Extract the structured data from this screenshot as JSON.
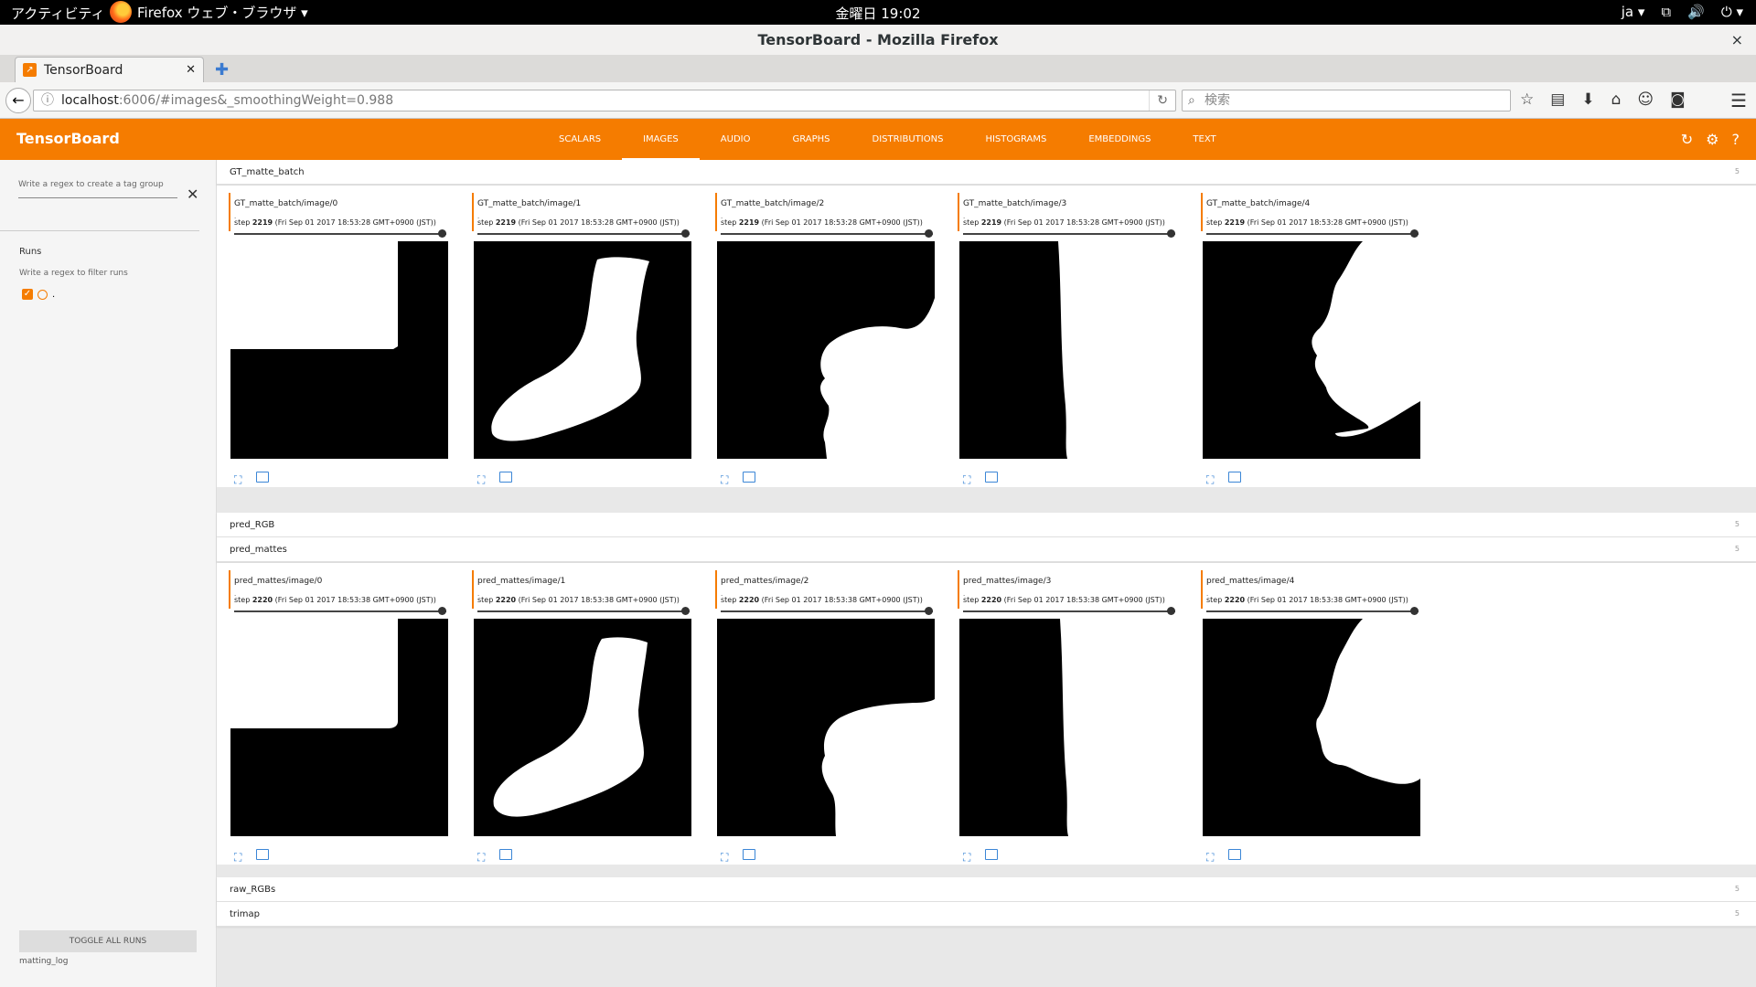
{
  "os_bar": {
    "activities": "アクティビティ",
    "app_menu": "Firefox ウェブ・ブラウザ ▾",
    "clock": "金曜日 19:02",
    "lang": "ja ▾",
    "net_icon": "⧉",
    "volume_icon": "🔊",
    "power_icon": "⏻ ▾"
  },
  "window": {
    "title": "TensorBoard - Mozilla Firefox",
    "close": "×"
  },
  "browser": {
    "tab_label": "TensorBoard",
    "tab_close": "✕",
    "new_tab": "✚",
    "url_host": "localhost",
    "url_rest": ":6006/#images&_smoothingWeight=0.988",
    "search_placeholder": "検索",
    "icons": [
      "☆",
      "▤",
      "⬇",
      "⌂",
      "☺",
      "◙"
    ],
    "menu_icon": "☰"
  },
  "tensorboard": {
    "brand": "TensorBoard",
    "tabs": [
      "SCALARS",
      "IMAGES",
      "AUDIO",
      "GRAPHS",
      "DISTRIBUTIONS",
      "HISTOGRAMS",
      "EMBEDDINGS",
      "TEXT"
    ],
    "active_tab": "IMAGES",
    "header_icons": {
      "refresh": "↻",
      "settings": "⚙",
      "help": "?"
    }
  },
  "sidebar": {
    "tag_regex_placeholder": "Write a regex to create a tag group",
    "clear": "✕",
    "runs_title": "Runs",
    "runs_filter_placeholder": "Write a regex to filter runs",
    "run_name": ".",
    "toggle_all": "TOGGLE ALL RUNS",
    "logdir": "matting_log"
  },
  "categories": [
    {
      "name": "GT_matte_batch",
      "count": "5"
    },
    {
      "name": "pred_RGB",
      "count": "5"
    },
    {
      "name": "pred_mattes",
      "count": "5"
    },
    {
      "name": "raw_RGBs",
      "count": "5"
    },
    {
      "name": "trimap",
      "count": "5"
    }
  ],
  "gt_cards": [
    {
      "title": "GT_matte_batch/image/0",
      "dot": ".",
      "step_label": "step",
      "step": "2219",
      "time": "(Fri Sep 01 2017 18:53:28 GMT+0900 (JST))"
    },
    {
      "title": "GT_matte_batch/image/1",
      "dot": ".",
      "step_label": "step",
      "step": "2219",
      "time": "(Fri Sep 01 2017 18:53:28 GMT+0900 (JST))"
    },
    {
      "title": "GT_matte_batch/image/2",
      "dot": ".",
      "step_label": "step",
      "step": "2219",
      "time": "(Fri Sep 01 2017 18:53:28 GMT+0900 (JST))"
    },
    {
      "title": "GT_matte_batch/image/3",
      "dot": ".",
      "step_label": "step",
      "step": "2219",
      "time": "(Fri Sep 01 2017 18:53:28 GMT+0900 (JST))"
    },
    {
      "title": "GT_matte_batch/image/4",
      "dot": ".",
      "step_label": "step",
      "step": "2219",
      "time": "(Fri Sep 01 2017 18:53:28 GMT+0900 (JST))"
    }
  ],
  "pred_cards": [
    {
      "title": "pred_mattes/image/0",
      "dot": ".",
      "step_label": "step",
      "step": "2220",
      "time": "(Fri Sep 01 2017 18:53:38 GMT+0900 (JST))"
    },
    {
      "title": "pred_mattes/image/1",
      "dot": ".",
      "step_label": "step",
      "step": "2220",
      "time": "(Fri Sep 01 2017 18:53:38 GMT+0900 (JST))"
    },
    {
      "title": "pred_mattes/image/2",
      "dot": ".",
      "step_label": "step",
      "step": "2220",
      "time": "(Fri Sep 01 2017 18:53:38 GMT+0900 (JST))"
    },
    {
      "title": "pred_mattes/image/3",
      "dot": ".",
      "step_label": "step",
      "step": "2220",
      "time": "(Fri Sep 01 2017 18:53:38 GMT+0900 (JST))"
    },
    {
      "title": "pred_mattes/image/4",
      "dot": ".",
      "step_label": "step",
      "step": "2220",
      "time": "(Fri Sep 01 2017 18:53:38 GMT+0900 (JST))"
    }
  ],
  "colors": {
    "accent": "#f57c00",
    "link": "#3b86d6"
  }
}
